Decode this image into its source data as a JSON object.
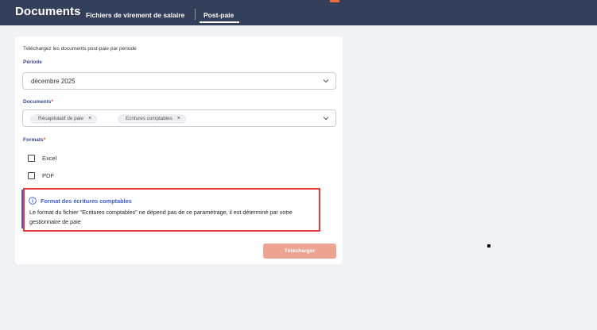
{
  "header": {
    "title": "Documents",
    "tabs": [
      {
        "label": "Fichiers de virement de salaire",
        "active": false
      },
      {
        "label": "Post-paie",
        "active": true
      }
    ]
  },
  "form": {
    "intro": "Téléchargez les documents post-paie par période",
    "periode": {
      "label": "Période",
      "value": "décembre 2025"
    },
    "documents": {
      "label": "Documents",
      "required_mark": "*",
      "chips": [
        "Récapitulatif de paie",
        "Ecritures comptables"
      ],
      "chip_remove_icon": "×"
    },
    "formats": {
      "label": "Formats",
      "required_mark": "*",
      "options": [
        {
          "label": "Excel",
          "checked": false
        },
        {
          "label": "PDF",
          "checked": false
        }
      ]
    },
    "info": {
      "title": "Format des écritures comptables",
      "text": "Le format du fichier \"Ecritures comptables\" ne dépend pas de ce paramétrage, il est déterminé par votre gestionnaire de paie"
    },
    "download_label": "Télécharger"
  },
  "colors": {
    "header_bg": "#34405a",
    "accent": "#f0683c",
    "label_blue": "#3a4a8a",
    "info_blue": "#3e5bd8",
    "highlight_red": "#e53a3a",
    "button_disabled": "#eca491"
  }
}
